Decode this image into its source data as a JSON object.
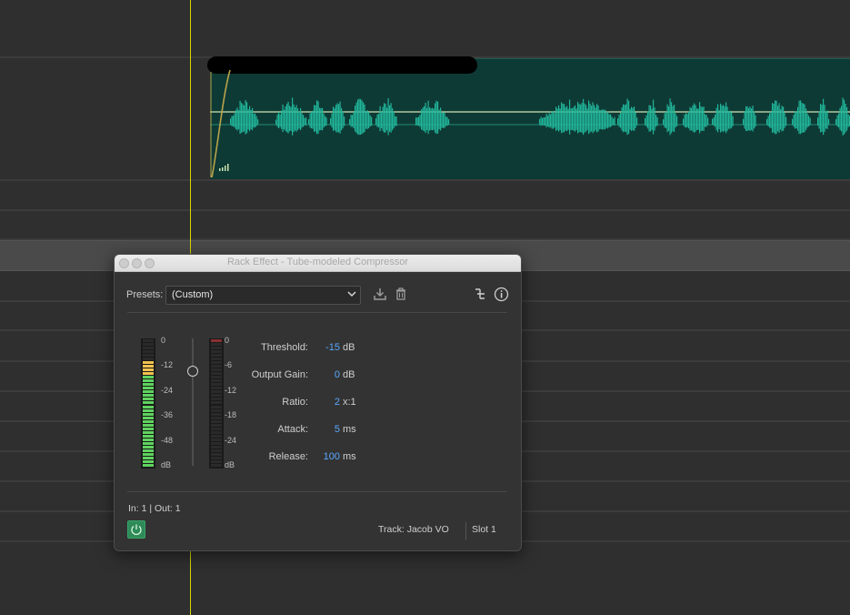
{
  "timeline": {
    "waveform_color": "#21b59a",
    "clip_bg": "#0e3a35",
    "playhead_color": "#d8d800"
  },
  "panel": {
    "title": "Rack Effect - Tube-modeled Compressor",
    "presets_label": "Presets:",
    "preset_value": "(Custom)",
    "icons": [
      "chevron-down-icon",
      "save-preset-icon",
      "trash-icon",
      "routing-icon",
      "info-icon"
    ],
    "left_meter": {
      "scale": [
        "0",
        "-12",
        "-24",
        "-36",
        "-48",
        "dB"
      ],
      "active_fraction": 0.82
    },
    "right_meter": {
      "scale": [
        "0",
        "-6",
        "-12",
        "-18",
        "-24",
        "dB"
      ]
    },
    "params": [
      {
        "label": "Threshold:",
        "value": "-15",
        "unit": "dB"
      },
      {
        "label": "Output Gain:",
        "value": "0",
        "unit": "dB"
      },
      {
        "label": "Ratio:",
        "value": "2",
        "unit": "x:1"
      },
      {
        "label": "Attack:",
        "value": "5",
        "unit": "ms"
      },
      {
        "label": "Release:",
        "value": "100",
        "unit": "ms"
      }
    ],
    "io_text": "In: 1 | Out: 1",
    "track_text": "Track: Jacob VO",
    "slot_text": "Slot 1",
    "colors": {
      "value": "#5aa8ff",
      "power": "#2e8b57",
      "meter_green": "#5fd35f",
      "meter_yellow": "#f2c14e"
    }
  }
}
